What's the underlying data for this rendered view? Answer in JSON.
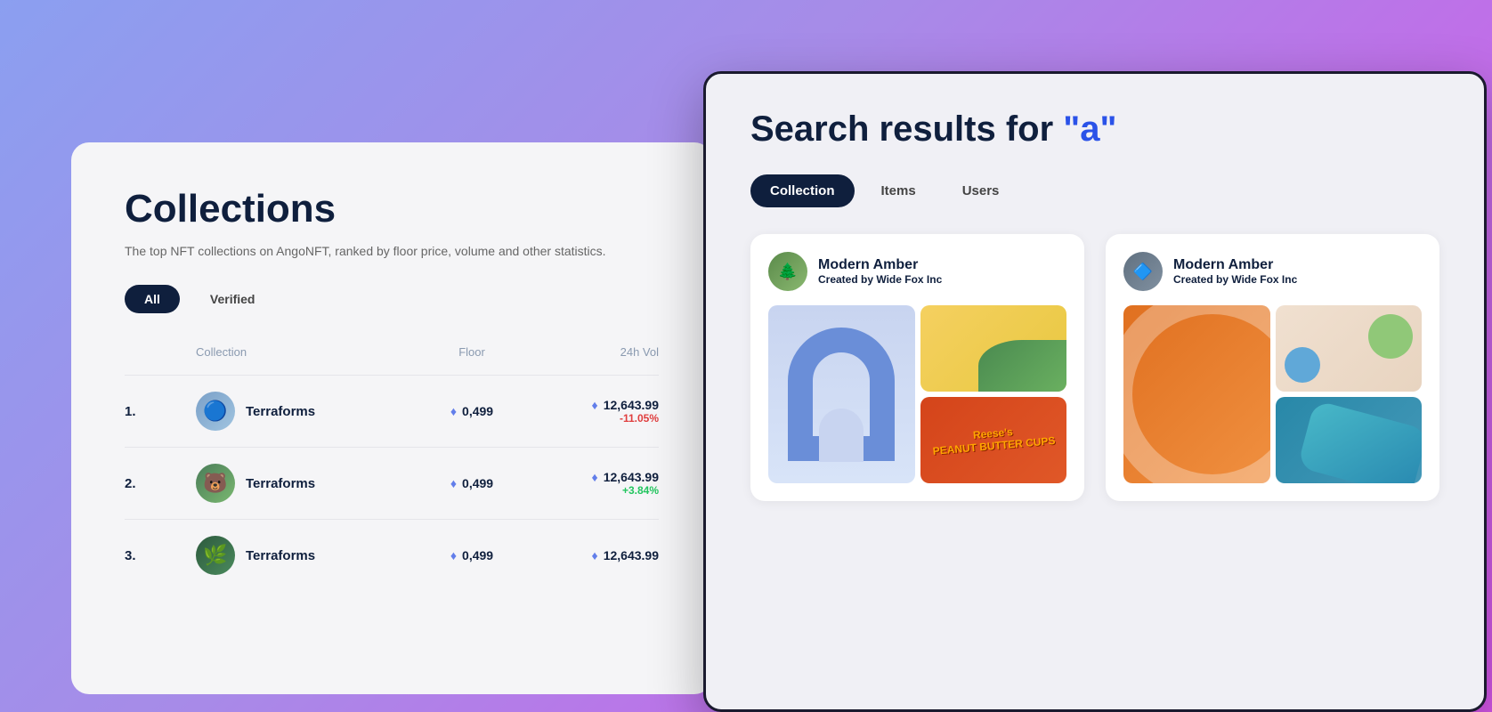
{
  "background": {
    "gradient": "purple-blue"
  },
  "left_panel": {
    "title": "Collections",
    "subtitle": "The top NFT collections on AngoNFT, ranked by floor price, volume and other statistics.",
    "filters": [
      {
        "id": "all",
        "label": "All",
        "active": true
      },
      {
        "id": "verified",
        "label": "Verified",
        "active": false
      }
    ],
    "table": {
      "columns": {
        "collection": "Collection",
        "floor": "Floor",
        "vol": "24h Vol"
      },
      "rows": [
        {
          "num": "1.",
          "name": "Terraforms",
          "floor": "0,499",
          "vol": "12,643.99",
          "change": "-11.05%",
          "change_type": "negative",
          "avatar_type": "1"
        },
        {
          "num": "2.",
          "name": "Terraforms",
          "floor": "0,499",
          "vol": "12,643.99",
          "change": "+3.84%",
          "change_type": "positive",
          "avatar_type": "2"
        },
        {
          "num": "3.",
          "name": "Terraforms",
          "floor": "0,499",
          "vol": "12,643.99",
          "change": "",
          "change_type": "",
          "avatar_type": "3"
        }
      ]
    }
  },
  "right_panel": {
    "search_title_prefix": "Search results for ",
    "search_query": "\"a\"",
    "tabs": [
      {
        "id": "collection",
        "label": "Collection",
        "active": true
      },
      {
        "id": "items",
        "label": "Items",
        "active": false
      },
      {
        "id": "users",
        "label": "Users",
        "active": false
      }
    ],
    "cards": [
      {
        "id": "card1",
        "name": "Modern Amber",
        "creator_prefix": "Created by",
        "creator": "Wide Fox Inc",
        "avatar_type": "forest"
      },
      {
        "id": "card2",
        "name": "Modern Amber",
        "creator_prefix": "Created by",
        "creator": "Wide Fox Inc",
        "avatar_type": "geo"
      }
    ]
  }
}
